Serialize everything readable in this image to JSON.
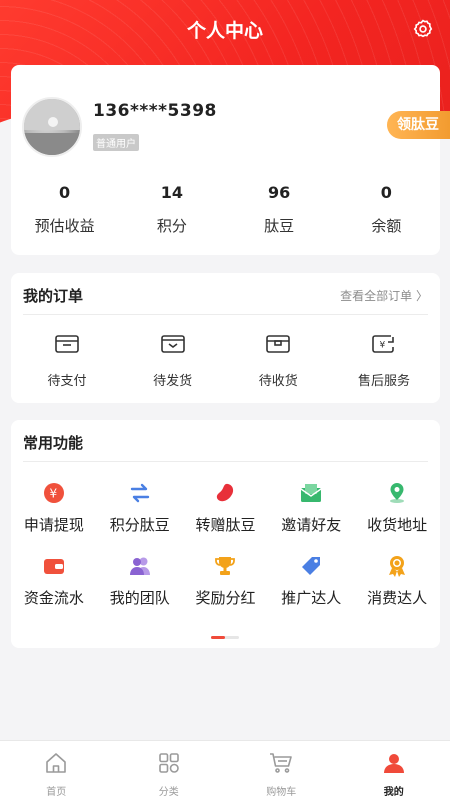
{
  "header": {
    "title": "个人中心",
    "settings_icon": "gear-icon"
  },
  "profile": {
    "phone": "136****5398",
    "level": "普通用户",
    "bean_button": "领肽豆",
    "stats": [
      {
        "value": "0",
        "label": "预估收益"
      },
      {
        "value": "14",
        "label": "积分"
      },
      {
        "value": "96",
        "label": "肽豆"
      },
      {
        "value": "0",
        "label": "余额"
      }
    ]
  },
  "orders": {
    "title": "我的订单",
    "view_all": "查看全部订单 〉",
    "items": [
      {
        "label": "待支付",
        "icon": "wallet-icon"
      },
      {
        "label": "待发货",
        "icon": "box-send-icon"
      },
      {
        "label": "待收货",
        "icon": "box-receive-icon"
      },
      {
        "label": "售后服务",
        "icon": "refund-icon"
      }
    ]
  },
  "functions": {
    "title": "常用功能",
    "items": [
      {
        "label": "申请提现",
        "icon": "yen-coin-icon",
        "color": "#f0513c"
      },
      {
        "label": "积分肽豆",
        "icon": "exchange-arrows-icon",
        "color": "#4a7fe3"
      },
      {
        "label": "转赠肽豆",
        "icon": "bean-icon",
        "color": "#e8303a"
      },
      {
        "label": "邀请好友",
        "icon": "envelope-icon",
        "color": "#37b86e"
      },
      {
        "label": "收货地址",
        "icon": "location-pin-icon",
        "color": "#37b86e"
      },
      {
        "label": "资金流水",
        "icon": "wallet-card-icon",
        "color": "#f0513c"
      },
      {
        "label": "我的团队",
        "icon": "team-icon",
        "color": "#8a63d2"
      },
      {
        "label": "奖励分红",
        "icon": "trophy-icon",
        "color": "#f3a21a"
      },
      {
        "label": "推广达人",
        "icon": "tag-icon",
        "color": "#4a7fe3"
      },
      {
        "label": "消费达人",
        "icon": "medal-icon",
        "color": "#f3a21a"
      }
    ]
  },
  "tabbar": [
    {
      "label": "首页",
      "icon": "home-icon"
    },
    {
      "label": "分类",
      "icon": "grid-icon"
    },
    {
      "label": "购物车",
      "icon": "cart-icon"
    },
    {
      "label": "我的",
      "icon": "user-icon"
    }
  ],
  "colors": {
    "brand_red": "#f32521",
    "accent_orange": "#f29b2f"
  }
}
